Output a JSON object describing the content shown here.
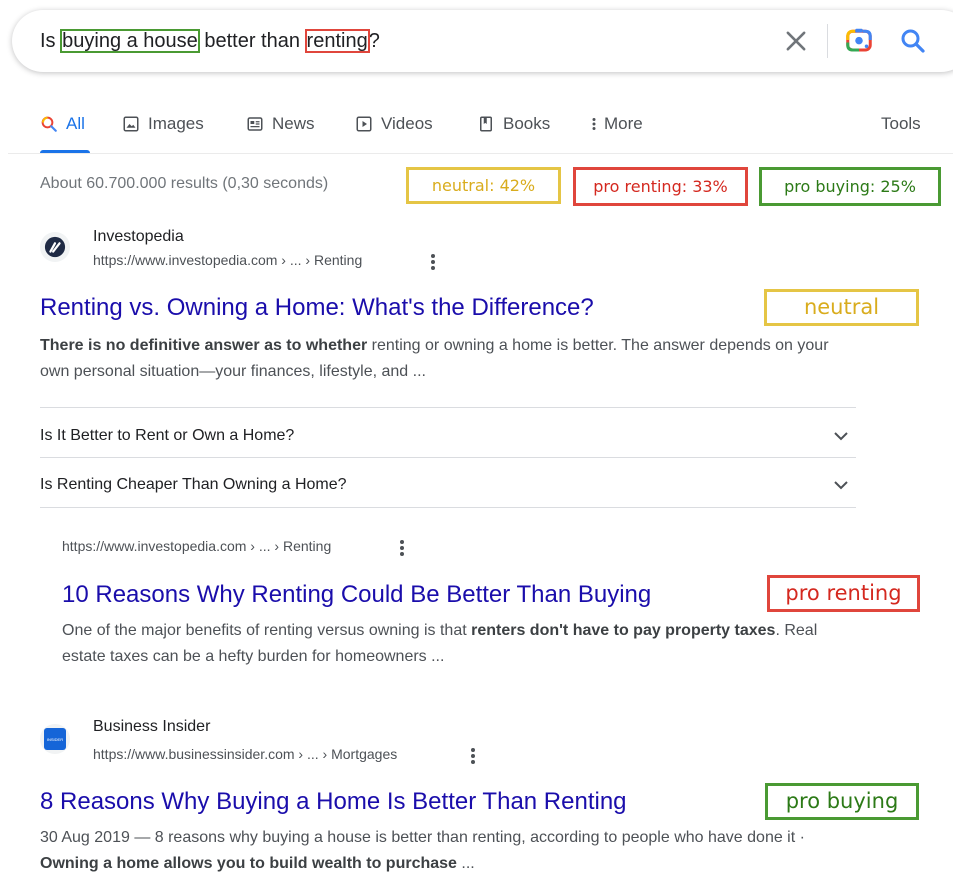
{
  "search": {
    "query_prefix": "Is ",
    "query_buying": "buying a house",
    "query_middle": " better than ",
    "query_renting": "renting",
    "query_suffix": "?"
  },
  "tabs": [
    {
      "label": "All"
    },
    {
      "label": "Images"
    },
    {
      "label": "News"
    },
    {
      "label": "Videos"
    },
    {
      "label": "Books"
    },
    {
      "label": "More"
    }
  ],
  "tools_label": "Tools",
  "stats_text": "About 60.700.000 results (0,30 seconds)",
  "summary": {
    "neutral": "neutral: 42%",
    "pro_renting": "pro renting: 33%",
    "pro_buying": "pro buying: 25%"
  },
  "results": [
    {
      "site_name": "Investopedia",
      "url": "https://www.investopedia.com › ... › Renting",
      "title": "Renting vs. Owning a Home: What's the Difference?",
      "tag": "neutral",
      "snippet_bold": "There is no definitive answer as to whether",
      "snippet_rest": " renting or owning a home is better. The answer depends on your own personal situation—your finances, lifestyle, and ...",
      "faqs": [
        "Is It Better to Rent or Own a Home?",
        "Is Renting Cheaper Than Owning a Home?"
      ]
    },
    {
      "url": "https://www.investopedia.com › ... › Renting",
      "title": "10 Reasons Why Renting Could Be Better Than Buying",
      "tag": "pro renting",
      "snippet_plain": "One of the major benefits of renting versus owning is that ",
      "snippet_bold": "renters don't have to pay property taxes",
      "snippet_rest": ". Real estate taxes can be a hefty burden for homeowners ..."
    },
    {
      "site_name": "Business Insider",
      "favicon_text": "INSIDER",
      "url": "https://www.businessinsider.com › ... › Mortgages",
      "title": "8 Reasons Why Buying a Home Is Better Than Renting",
      "tag": "pro buying",
      "snippet_plain": "30 Aug 2019 — 8 reasons why buying a house is better than renting, according to people who have done it · ",
      "snippet_bold": "Owning a home allows you to build wealth to purchase",
      "snippet_rest": " ..."
    }
  ],
  "colors": {
    "link": "#1a0dab",
    "accent": "#1a73e8",
    "neutral_box": "#e5c545",
    "renting_box": "#e0463c",
    "buying_box": "#4a9a33"
  },
  "icons": [
    "close-icon",
    "google-lens-icon",
    "search-icon",
    "images-icon",
    "news-icon",
    "videos-icon",
    "books-icon",
    "more-dots-icon",
    "kebab-menu-icon",
    "chevron-down-icon"
  ]
}
